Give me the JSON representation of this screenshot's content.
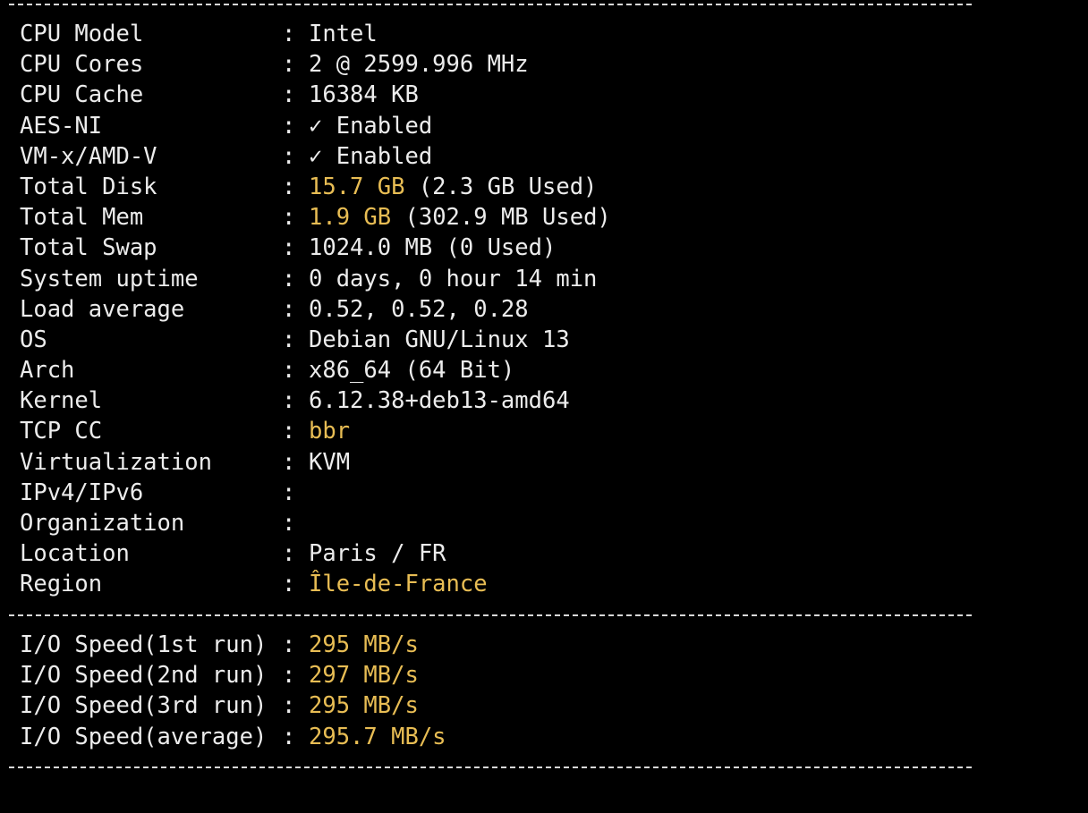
{
  "colors": {
    "background": "#000000",
    "text": "#ececec",
    "highlight": "#e8bd54"
  },
  "system_info": [
    {
      "key": "CPU Model",
      "value": "Intel"
    },
    {
      "key": "CPU Cores",
      "value": "2 @ 2599.996 MHz"
    },
    {
      "key": "CPU Cache",
      "value": "16384 KB"
    },
    {
      "key": "AES-NI",
      "check": "✓",
      "value": "Enabled"
    },
    {
      "key": "VM-x/AMD-V",
      "check": "✓",
      "value": "Enabled"
    },
    {
      "key": "Total Disk",
      "value_highlight": "15.7 GB",
      "value": "(2.3 GB Used)"
    },
    {
      "key": "Total Mem",
      "value_highlight": "1.9 GB",
      "value": "(302.9 MB Used)"
    },
    {
      "key": "Total Swap",
      "value": "1024.0 MB (0 Used)"
    },
    {
      "key": "System uptime",
      "value": "0 days, 0 hour 14 min"
    },
    {
      "key": "Load average",
      "value": "0.52, 0.52, 0.28"
    },
    {
      "key": "OS",
      "value": "Debian GNU/Linux 13"
    },
    {
      "key": "Arch",
      "value": "x86_64 (64 Bit)"
    },
    {
      "key": "Kernel",
      "value": "6.12.38+deb13-amd64"
    },
    {
      "key": "TCP CC",
      "value_highlight": "bbr"
    },
    {
      "key": "Virtualization",
      "value": "KVM"
    },
    {
      "key": "IPv4/IPv6",
      "value": ""
    },
    {
      "key": "Organization",
      "value": ""
    },
    {
      "key": "Location",
      "value": "Paris / FR"
    },
    {
      "key": "Region",
      "value_highlight": "Île-de-France"
    }
  ],
  "io_speed": [
    {
      "key": "I/O Speed(1st run)",
      "value_highlight": "295 MB/s"
    },
    {
      "key": "I/O Speed(2nd run)",
      "value_highlight": "297 MB/s"
    },
    {
      "key": "I/O Speed(3rd run)",
      "value_highlight": "295 MB/s"
    },
    {
      "key": "I/O Speed(average)",
      "value_highlight": "295.7 MB/s"
    }
  ],
  "colon": ":"
}
